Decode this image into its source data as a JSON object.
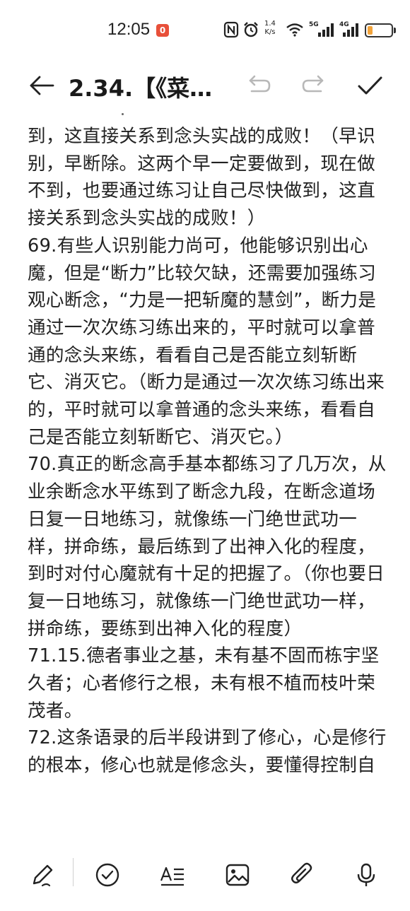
{
  "status_bar": {
    "time": "12:05",
    "notification_badge": "0",
    "net_speed_value": "1.4",
    "net_speed_unit": "K/s",
    "signal1_label": "5G",
    "signal2_label": "4G",
    "battery_level": 0.22,
    "battery_color": "#f2a33a"
  },
  "title_bar": {
    "title": "2.34.【《菜…",
    "back_icon": "arrow-left-icon",
    "undo_icon": "undo-icon",
    "redo_icon": "redo-icon",
    "done_icon": "checkmark-icon"
  },
  "content": {
    "paragraphs": [
      "到，这直接关系到念头实战的成败！（早识别，早断除。这两个早一定要做到，现在做不到，也要通过练习让自己尽快做到，这直接关系到念头实战的成败！）",
      "69.有些人识别能力尚可，他能够识别出心魔，但是“断力”比较欠缺，还需要加强练习观心断念，“力是一把斩魔的慧剑”，断力是通过一次次练习练出来的，平时就可以拿普通的念头来练，看看自己是否能立刻斩断它、消灭它。（断力是通过一次次练习练出来的，平时就可以拿普通的念头来练，看看自己是否能立刻斩断它、消灭它。）",
      "70.真正的断念高手基本都练习了几万次，从业余断念水平练到了断念九段，在断念道场日复一日地练习，就像练一门绝世武功一样，拼命练，最后练到了出神入化的程度，到时对付心魔就有十足的把握了。（你也要日复一日地练习，就像练一门绝世武功一样，拼命练，要练到出神入化的程度）",
      "71.15.德者事业之基，未有基不固而栋宇坚久者；心者修行之根，未有根不植而枝叶荣茂者。",
      "72.这条语录的后半段讲到了修心，心是修行的根本，修心也就是修念头，要懂得控制自"
    ]
  },
  "toolbar": {
    "items": [
      "pen-icon",
      "checklist-icon",
      "text-format-icon",
      "image-icon",
      "attachment-icon",
      "microphone-icon"
    ]
  }
}
